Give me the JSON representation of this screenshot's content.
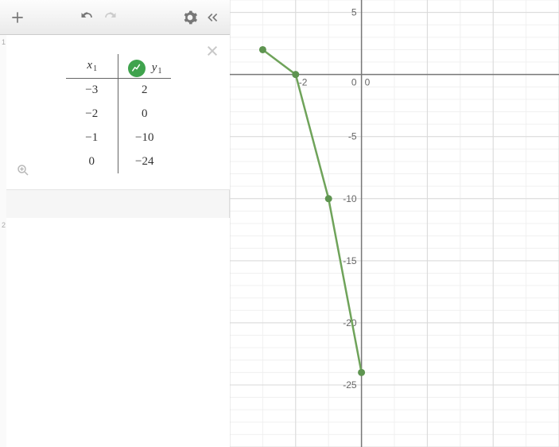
{
  "toolbar": {
    "add": "add",
    "undo": "undo",
    "redo": "redo",
    "settings": "settings",
    "collapse": "collapse"
  },
  "panel": {
    "row1_index": "1",
    "row2_index": "2",
    "header": {
      "x_var": "x",
      "x_sub": "1",
      "y_var": "y",
      "y_sub": "1"
    },
    "rows": [
      {
        "x": "−3",
        "y": "2"
      },
      {
        "x": "−2",
        "y": "0"
      },
      {
        "x": "−1",
        "y": "−10"
      },
      {
        "x": "0",
        "y": "−24"
      }
    ]
  },
  "graph": {
    "x_ticks": [
      {
        "v": -2,
        "label": "-2"
      },
      {
        "v": 0,
        "label": "0"
      }
    ],
    "y_ticks": [
      {
        "v": 5,
        "label": "5"
      },
      {
        "v": 0,
        "label": "0"
      },
      {
        "v": -5,
        "label": "-5"
      },
      {
        "v": -10,
        "label": "-10"
      },
      {
        "v": -15,
        "label": "-15"
      },
      {
        "v": -20,
        "label": "-20"
      },
      {
        "v": -25,
        "label": "-25"
      }
    ]
  },
  "chart_data": {
    "type": "line",
    "series": [
      {
        "name": "y1",
        "points": [
          {
            "x": -3,
            "y": 2
          },
          {
            "x": -2,
            "y": 0
          },
          {
            "x": -1,
            "y": -10
          },
          {
            "x": 0,
            "y": -24
          }
        ]
      }
    ],
    "xlabel": "x1",
    "ylabel": "y1",
    "xlim": [
      -4,
      6
    ],
    "ylim": [
      -30,
      6
    ],
    "grid": true
  }
}
